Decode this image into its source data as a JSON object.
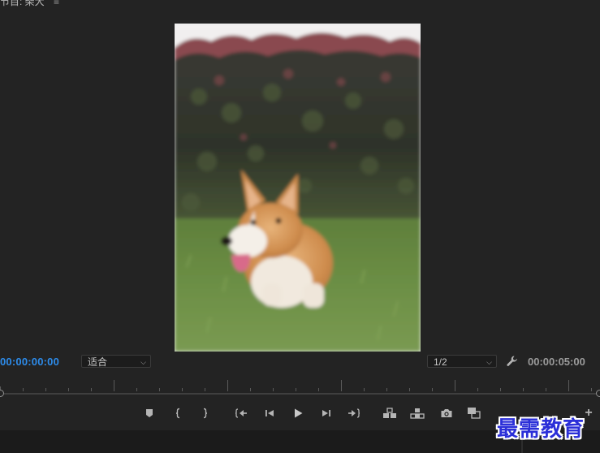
{
  "panel": {
    "title": "节目: 柴犬",
    "menu_glyph": "≡"
  },
  "video": {
    "subject": "corgi-dog-on-grass"
  },
  "controls": {
    "current_timecode": "00:00:00:00",
    "zoom_label": "适合",
    "resolution_label": "1/2",
    "duration_timecode": "00:00:05:00",
    "caret": "⌵",
    "settings_icon": "wrench-icon"
  },
  "transport": {
    "buttons": [
      {
        "name": "add-marker-button",
        "icon": "marker-icon"
      },
      {
        "name": "mark-in-button",
        "icon": "mark-in-icon"
      },
      {
        "name": "mark-out-button",
        "icon": "mark-out-icon"
      },
      {
        "name": "go-to-in-button",
        "icon": "go-to-in-icon"
      },
      {
        "name": "step-back-button",
        "icon": "step-back-icon"
      },
      {
        "name": "play-button",
        "icon": "play-icon"
      },
      {
        "name": "step-forward-button",
        "icon": "step-forward-icon"
      },
      {
        "name": "go-to-out-button",
        "icon": "go-to-out-icon"
      },
      {
        "name": "insert-button",
        "icon": "insert-icon"
      },
      {
        "name": "overwrite-button",
        "icon": "overwrite-icon"
      },
      {
        "name": "export-frame-button",
        "icon": "camera-icon"
      },
      {
        "name": "comparison-view-button",
        "icon": "comparison-icon"
      }
    ],
    "more_glyph": "+"
  },
  "colors": {
    "background": "#232323",
    "timecode_accent": "#2d8ceb",
    "icon": "#b5b5b5"
  },
  "watermark": {
    "text": "最需教育"
  }
}
